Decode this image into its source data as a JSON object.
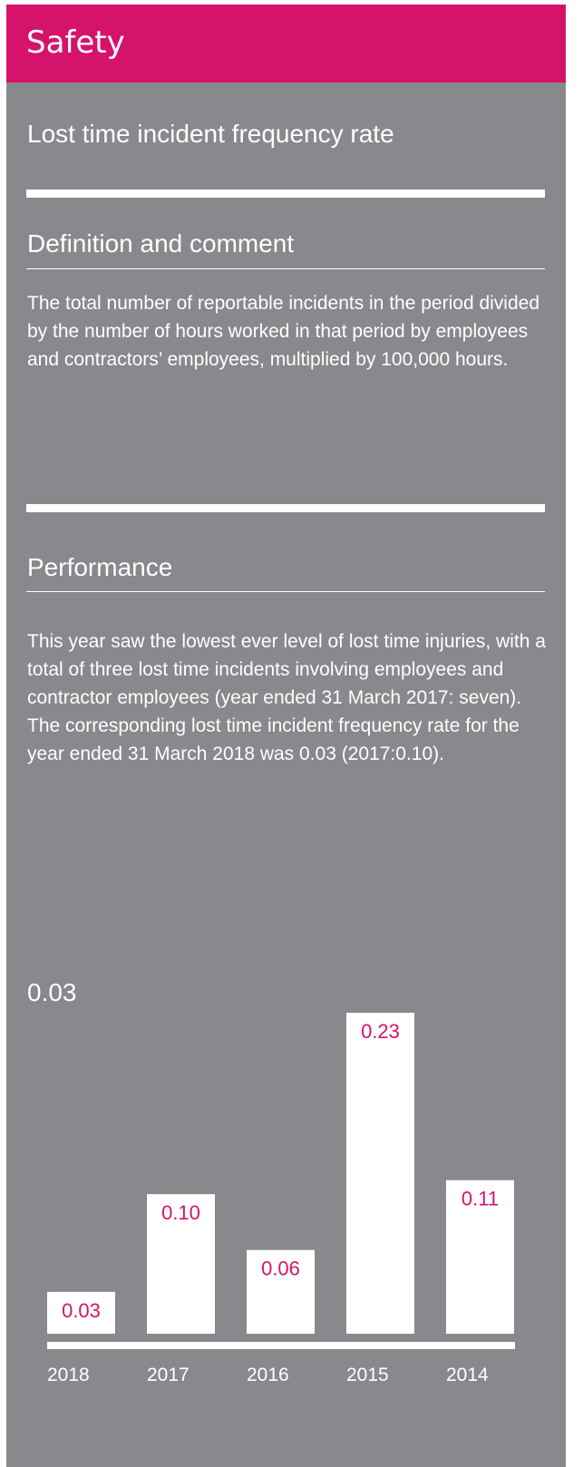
{
  "header": {
    "title": "Safety"
  },
  "kpi": {
    "title": "Lost time incident frequency rate"
  },
  "definition": {
    "heading": "Definition and comment",
    "text": "The total number of reportable incidents in the period divided by the number of hours worked in that period by employees and contractors’ employees, multiplied by 100,000 hours."
  },
  "performance": {
    "heading": "Performance",
    "text": "This year saw the lowest ever level of lost time injuries, with a total of three lost time incidents involving employees and contractor employees (year ended 31 March 2017: seven). The corresponding lost time incident frequency rate for the year ended 31 March 2018 was 0.03 (2017:0.10)."
  },
  "current_value": "0.03",
  "colors": {
    "accent": "#d6136b",
    "panel": "#88898c",
    "bar": "#ffffff"
  },
  "chart_data": {
    "type": "bar",
    "categories": [
      "2018",
      "2017",
      "2016",
      "2015",
      "2014"
    ],
    "values": [
      0.03,
      0.1,
      0.06,
      0.23,
      0.11
    ],
    "value_labels": [
      "0.03",
      "0.10",
      "0.06",
      "0.23",
      "0.11"
    ],
    "title": "",
    "xlabel": "",
    "ylabel": "",
    "ylim": [
      0,
      0.23
    ],
    "grid": false,
    "legend": "none"
  }
}
